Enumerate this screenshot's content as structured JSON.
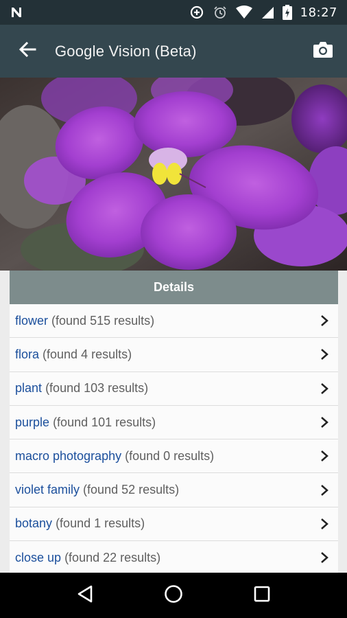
{
  "status_bar": {
    "time": "18:27",
    "icons": [
      "n-notification-icon",
      "data-saver-icon",
      "alarm-icon",
      "wifi-icon",
      "signal-icon",
      "battery-icon"
    ]
  },
  "app_bar": {
    "title": "Google Vision (Beta)",
    "back_icon": "arrow-back-icon",
    "action_icon": "camera-icon"
  },
  "hero": {
    "subject": "purple African violet flower"
  },
  "details": {
    "header": "Details",
    "items": [
      {
        "label": "flower",
        "count": "(found 515 results)"
      },
      {
        "label": "flora",
        "count": "(found 4 results)"
      },
      {
        "label": "plant",
        "count": "(found 103 results)"
      },
      {
        "label": "purple",
        "count": "(found 101 results)"
      },
      {
        "label": "macro photography",
        "count": "(found 0 results)"
      },
      {
        "label": "violet family",
        "count": "(found 52 results)"
      },
      {
        "label": "botany",
        "count": "(found 1 results)"
      },
      {
        "label": "close up",
        "count": "(found 22 results)"
      }
    ]
  },
  "nav_bar": {
    "buttons": [
      "back-triangle-icon",
      "home-circle-icon",
      "recents-square-icon"
    ]
  },
  "colors": {
    "status_bar": "#233137",
    "app_bar": "#34474f",
    "panel_header": "#7d8c8c",
    "link": "#1b4f9c",
    "count_text": "#5f5f5f"
  }
}
